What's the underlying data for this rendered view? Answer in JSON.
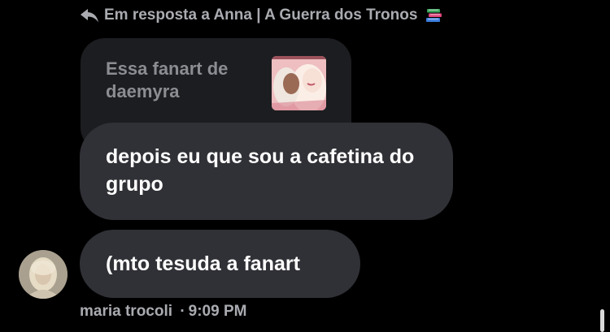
{
  "reply_header": {
    "text": "Em resposta a Anna | A Guerra dos Tronos",
    "icon_left": "reply-arrow-icon",
    "icon_right": "books-icon"
  },
  "quoted_message": {
    "text": "Essa fanart de daemyra",
    "thumbnail": "fanart-thumbnail"
  },
  "messages": [
    {
      "text": "depois eu que sou a cafetina do grupo"
    },
    {
      "text": "(mto tesuda a fanart"
    }
  ],
  "sender": {
    "name": "maria trocoli",
    "separator": "·",
    "time": "9:09 PM",
    "avatar": "avatar"
  },
  "colors": {
    "background": "#000000",
    "bubble": "#303136",
    "quoted_bubble": "#1c1d20",
    "meta_text": "#a9abb0"
  }
}
